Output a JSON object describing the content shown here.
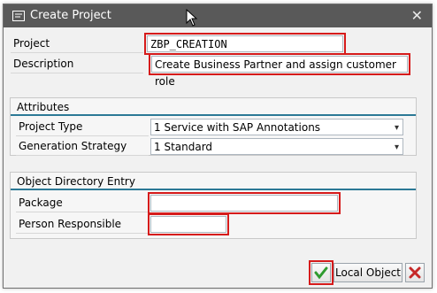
{
  "window": {
    "title": "Create Project",
    "icon": "create-project-icon",
    "close_icon": "close-icon"
  },
  "form": {
    "project_label": "Project",
    "project_value": "ZBP_CREATION",
    "description_label": "Description",
    "description_value": "Create Business Partner and assign customer role"
  },
  "attributes": {
    "title": "Attributes",
    "project_type_label": "Project Type",
    "project_type_value": "1 Service with SAP Annotations",
    "generation_strategy_label": "Generation Strategy",
    "generation_strategy_value": "1 Standard"
  },
  "object_directory": {
    "title": "Object Directory Entry",
    "package_label": "Package",
    "person_responsible_label": "Person Responsible"
  },
  "footer": {
    "confirm_icon": "checkmark-icon",
    "local_object_label": "Local Object",
    "cancel_icon": "cancel-x-icon"
  },
  "colors": {
    "titlebar": "#595959",
    "highlight": "#d61b1b",
    "section_rule": "#2c7996",
    "mask": "#0d3b3c"
  }
}
